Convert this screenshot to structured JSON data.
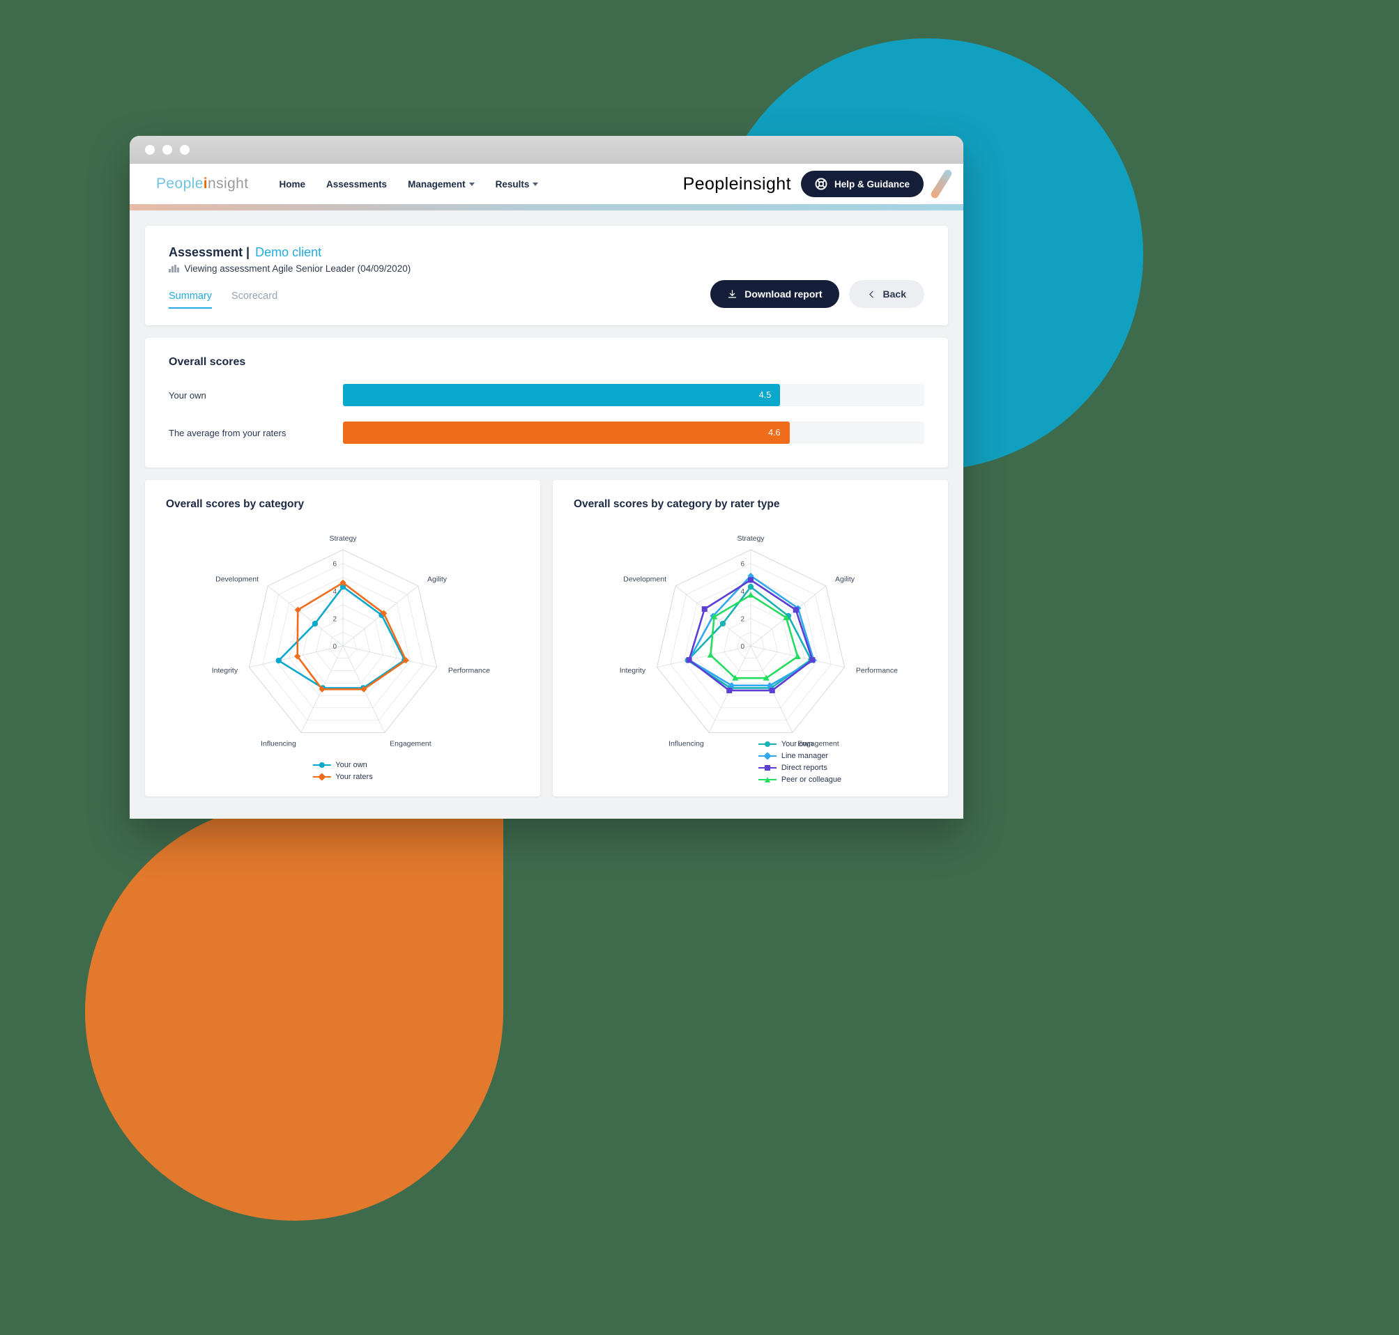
{
  "window": {
    "traffic_lights": [
      "close",
      "minimize",
      "maximize"
    ]
  },
  "nav": {
    "brand": {
      "part1": "People",
      "part2": "i",
      "part3": "nsight"
    },
    "links": [
      {
        "label": "Home",
        "has_caret": false
      },
      {
        "label": "Assessments",
        "has_caret": false
      },
      {
        "label": "Management",
        "has_caret": true
      },
      {
        "label": "Results",
        "has_caret": true
      }
    ],
    "brand_right": {
      "part1": "People",
      "part2": "i",
      "part3": "nsight"
    },
    "help_button": "Help & Guidance"
  },
  "header": {
    "title": "Assessment |",
    "client": "Demo client",
    "subtitle": "Viewing assessment Agile Senior Leader (04/09/2020)",
    "tabs": [
      {
        "label": "Summary",
        "active": true
      },
      {
        "label": "Scorecard",
        "active": false
      }
    ],
    "download_button": "Download report",
    "back_button": "Back"
  },
  "overall_scores": {
    "title": "Overall scores",
    "rows": [
      {
        "label": "Your own",
        "value": "4.5",
        "pct": 75.2,
        "color": "#0ba8ce"
      },
      {
        "label": "The average from your raters",
        "value": "4.6",
        "pct": 76.8,
        "color": "#ef6c1a"
      }
    ]
  },
  "colors": {
    "cyan": "#0ba8ce",
    "orange": "#ef6c1a",
    "teal": "#17b2b5",
    "light_blue": "#2fa8f0",
    "purple": "#5b3fd4",
    "green": "#23dd5e",
    "navy": "#151e38",
    "grid": "#d6d8dc",
    "deco_teal": "#12a0c0",
    "deco_orange": "#e2792c",
    "page_bg": "#3f6b4d"
  },
  "chart_data": [
    {
      "type": "radar",
      "title": "Overall scores by category",
      "categories": [
        "Strategy",
        "Agility",
        "Performance",
        "Engagement",
        "Influencing",
        "Integrity",
        "Development"
      ],
      "rlim": [
        0,
        7
      ],
      "ticks": [
        0,
        2,
        4,
        6
      ],
      "tick_labels": [
        "0",
        "2",
        "4",
        "6"
      ],
      "grid": true,
      "legend_position": "bottom",
      "series": [
        {
          "name": "Your own",
          "color": "#0ba8ce",
          "marker": "circle",
          "values": [
            4.3,
            3.6,
            4.6,
            3.4,
            3.4,
            4.8,
            2.6
          ]
        },
        {
          "name": "Your raters",
          "color": "#ef6c1a",
          "marker": "diamond",
          "values": [
            4.6,
            3.8,
            4.7,
            3.5,
            3.5,
            3.4,
            4.2
          ]
        }
      ]
    },
    {
      "type": "radar",
      "title": "Overall scores by category by rater type",
      "categories": [
        "Strategy",
        "Agility",
        "Performance",
        "Engagement",
        "Influencing",
        "Integrity",
        "Development"
      ],
      "rlim": [
        0,
        7
      ],
      "ticks": [
        0,
        2,
        4,
        6
      ],
      "tick_labels": [
        "0",
        "2",
        "4",
        "6"
      ],
      "grid": true,
      "legend_position": "bottom",
      "series": [
        {
          "name": "Your own",
          "color": "#17b2b5",
          "marker": "circle",
          "values": [
            4.3,
            3.5,
            4.5,
            3.4,
            3.4,
            4.7,
            2.6
          ]
        },
        {
          "name": "Line manager",
          "color": "#2fa8f0",
          "marker": "diamond",
          "values": [
            5.1,
            4.4,
            4.7,
            3.2,
            3.2,
            4.6,
            3.5
          ]
        },
        {
          "name": "Direct reports",
          "color": "#5b3fd4",
          "marker": "square",
          "values": [
            4.8,
            4.2,
            4.6,
            3.6,
            3.6,
            4.6,
            4.3
          ]
        },
        {
          "name": "Peer or colleague",
          "color": "#23dd5e",
          "marker": "triangle",
          "values": [
            3.7,
            3.3,
            3.5,
            2.6,
            2.6,
            3.0,
            3.4
          ]
        }
      ]
    }
  ]
}
